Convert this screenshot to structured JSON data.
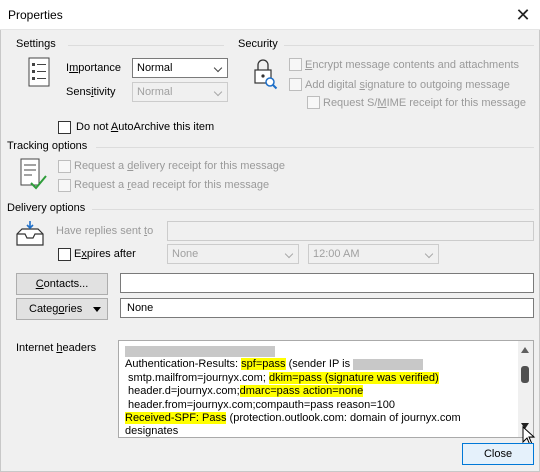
{
  "window": {
    "title": "Properties"
  },
  "settings": {
    "heading": "Settings",
    "importance": {
      "label_pre": "I",
      "label_u": "m",
      "label_post": "portance",
      "value": "Normal"
    },
    "sensitivity": {
      "label_pre": "Sens",
      "label_u": "i",
      "label_post": "tivity",
      "value": "Normal"
    },
    "autoarchive": {
      "pre": "Do not ",
      "u": "A",
      "post": "utoArchive this item",
      "checked": false
    }
  },
  "security": {
    "heading": "Security",
    "encrypt": {
      "pre": "",
      "u": "E",
      "post": "ncrypt message contents and attachments"
    },
    "signature": {
      "pre": "Add digital ",
      "u": "s",
      "post": "ignature to outgoing message"
    },
    "smime": {
      "pre": "Request S/",
      "u": "M",
      "post": "IME receipt for this message"
    }
  },
  "tracking": {
    "heading": "Tracking options",
    "delivery": {
      "pre": "Request a ",
      "u": "d",
      "post": "elivery receipt for this message"
    },
    "read": {
      "pre": "Request a ",
      "u": "r",
      "post": "ead receipt for this message"
    }
  },
  "delivery": {
    "heading": "Delivery options",
    "replies_pre": "Have replies sent ",
    "replies_u": "t",
    "replies_post": "o",
    "expires": {
      "pre": "E",
      "u": "x",
      "post": "pires after",
      "checked": false
    },
    "date": "None",
    "time": "12:00 AM"
  },
  "contacts": {
    "button_pre": "",
    "button_u": "C",
    "button_post": "ontacts...",
    "value": ""
  },
  "categories": {
    "button_pre": "Categ",
    "button_u": "o",
    "button_post": "ries",
    "value": "None"
  },
  "internet_headers": {
    "label_pre": "Internet ",
    "label_u": "h",
    "label_post": "eaders",
    "line1_pre": "Authentication-Results: ",
    "line1_hl": "spf=pass",
    "line1_post": " (sender IP is ",
    "line2_pre": " smtp.mailfrom=journyx.com; ",
    "line2_hl": "dkim=pass (signature was verified)",
    "line3_pre": " header.d=journyx.com;",
    "line3_hl": "dmarc=pass action=none",
    "line4": " header.from=journyx.com;compauth=pass reason=100",
    "line5_hl": "Received-SPF: Pass",
    "line5_post": " (protection.outlook.com: domain of journyx.com",
    "line6": "designates"
  },
  "footer": {
    "close_label": "Close"
  },
  "colors": {
    "highlight": "#ffff00",
    "accent": "#0078d7"
  }
}
